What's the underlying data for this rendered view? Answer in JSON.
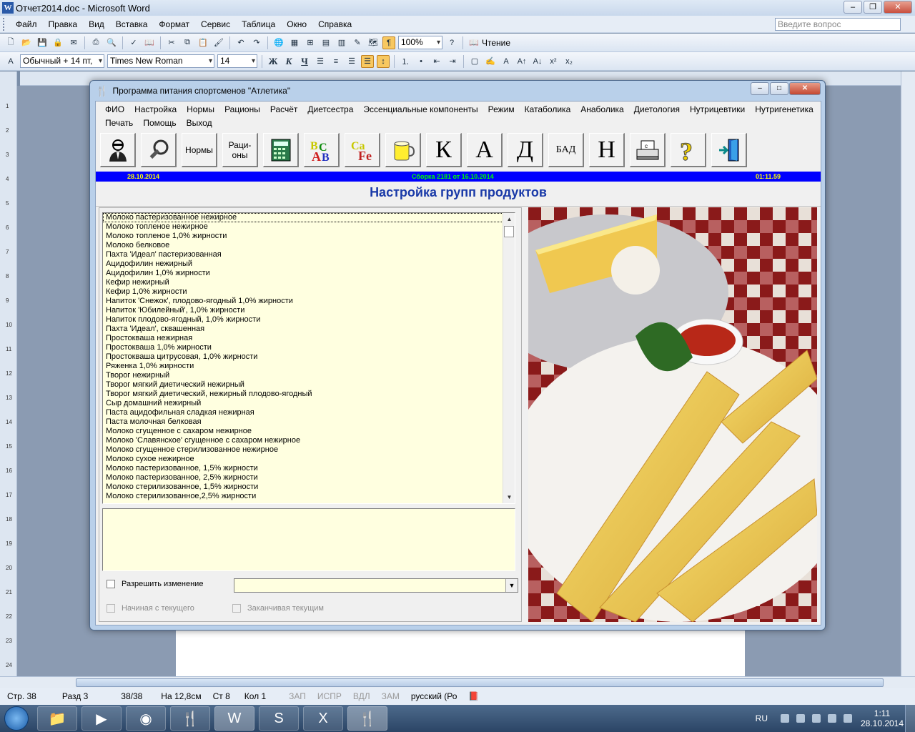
{
  "word": {
    "title": "Отчет2014.doc - Microsoft Word",
    "menu": [
      "Файл",
      "Правка",
      "Вид",
      "Вставка",
      "Формат",
      "Сервис",
      "Таблица",
      "Окно",
      "Справка"
    ],
    "ask_placeholder": "Введите вопрос",
    "zoom": "100%",
    "reading_label": "Чтение",
    "style_value": "Обычный + 14 пт,",
    "font_value": "Times New Roman",
    "size_value": "14",
    "bold_glyph": "Ж",
    "italic_glyph": "К",
    "underline_glyph": "Ч",
    "status": {
      "page": "Стр. 38",
      "section": "Разд 3",
      "pages": "38/38",
      "position": "На 12,8см",
      "line": "Ст 8",
      "column": "Кол 1",
      "rec": "ЗАП",
      "trk": "ИСПР",
      "ext": "ВДЛ",
      "ovr": "ЗАМ",
      "lang": "русский (Ро"
    },
    "ruler_numbers": [
      "1",
      "2",
      "3",
      "4",
      "5",
      "6",
      "7",
      "8",
      "9",
      "10",
      "11",
      "12",
      "13",
      "14",
      "15",
      "16",
      "17",
      "18",
      "19",
      "20",
      "21",
      "22",
      "23",
      "24"
    ]
  },
  "app": {
    "title": "Программа питания спортсменов \"Атлетика\"",
    "menu": [
      "ФИО",
      "Настройка",
      "Нормы",
      "Рационы",
      "Расчёт",
      "Диетсестра",
      "Эссенциальные компоненты",
      "Режим",
      "Катаболика",
      "Анаболика",
      "Диетология",
      "Нутрицевтики",
      "Нутригенетика",
      "Печать",
      "Помощь",
      "Выход"
    ],
    "toolbar": {
      "norms": "Нормы",
      "rations": "Раци-\nоны",
      "letter_k": "К",
      "letter_a": "А",
      "letter_d": "Д",
      "bad": "БАД",
      "letter_n": "Н",
      "question": "?"
    },
    "infobar": {
      "date": "28.10.2014",
      "build": "Сборка 2181 от 16.10.2014",
      "time": "01:11.59"
    },
    "heading": "Настройка групп продуктов",
    "products": [
      "Молоко пастеризованное нежирное",
      "Молоко топленое нежирное",
      "Молоко топленое 1,0% жирности",
      "Молоко белковое",
      "Пахта 'Идеал' пастеризованная",
      "Ацидофилин нежирный",
      "Ацидофилин 1,0% жирности",
      "Кефир нежирный",
      "Кефир 1,0% жирности",
      "Напиток 'Снежок', плодово-ягодный 1,0% жирности",
      "Напиток 'Юбилейный', 1,0% жирности",
      "Напиток плодово-ягодный, 1,0% жирности",
      "Пахта 'Идеал', сквашенная",
      "Простокваша нежирная",
      "Простокваша 1,0% жирности",
      "Простокваша цитрусовая, 1,0% жирности",
      "Ряженка 1,0% жирности",
      "Творог нежирный",
      "Творог мягкий диетический нежирный",
      "Творог мягкий диетический, нежирный плодово-ягодный",
      "Сыр домашний нежирный",
      "Паста ацидофильная сладкая нежирная",
      "Паста молочная белковая",
      "Молоко сгущенное с сахаром нежирное",
      "Молоко 'Славянское' сгущенное с сахаром нежирное",
      "Молоко сгущенное стерилизованное нежирное",
      "Молоко сухое нежирное",
      "Молоко пастеризованное, 1,5% жирности",
      "Молоко пастеризованное, 2,5% жирности",
      "Молоко стерилизованное, 1,5% жирности",
      "Молоко стерилизованное,2,5% жирности"
    ],
    "allow_change": "Разрешить изменение",
    "from_current": "Начиная с текущего",
    "to_current": "Заканчивая текущим"
  },
  "taskbar": {
    "lang": "RU",
    "time": "1:11",
    "date": "28.10.2014"
  }
}
